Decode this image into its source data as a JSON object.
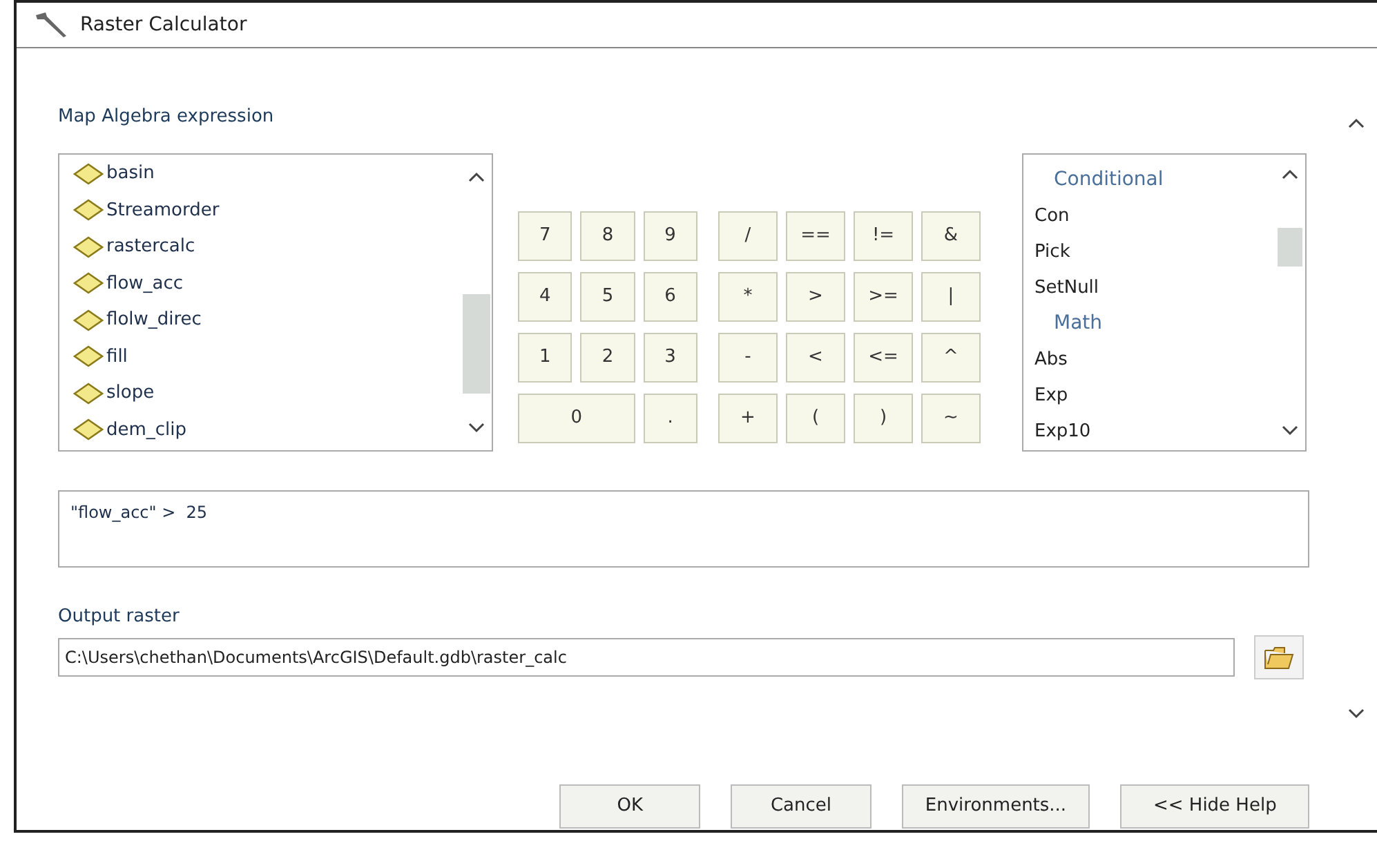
{
  "window": {
    "title": "Raster Calculator"
  },
  "expression_label": "Map Algebra expression",
  "layers": [
    "basin",
    "Streamorder",
    "rastercalc",
    "flow_acc",
    "flolw_direc",
    "fill",
    "slope",
    "dem_clip"
  ],
  "digit_keys": [
    {
      "label": "7",
      "kind": "normal"
    },
    {
      "label": "8",
      "kind": "normal"
    },
    {
      "label": "9",
      "kind": "normal"
    },
    {
      "label": "4",
      "kind": "normal"
    },
    {
      "label": "5",
      "kind": "normal"
    },
    {
      "label": "6",
      "kind": "normal"
    },
    {
      "label": "1",
      "kind": "normal"
    },
    {
      "label": "2",
      "kind": "normal"
    },
    {
      "label": "3",
      "kind": "normal"
    },
    {
      "label": "0",
      "kind": "wide"
    },
    {
      "label": ".",
      "kind": "normal"
    }
  ],
  "operator_keys": [
    "/",
    "==",
    "!=",
    "&",
    "*",
    ">",
    ">=",
    "|",
    "-",
    "<",
    "<=",
    "^",
    "+",
    "(",
    ")",
    "~"
  ],
  "functions": [
    {
      "label": "Conditional",
      "kind": "heading"
    },
    {
      "label": "Con",
      "kind": "function"
    },
    {
      "label": "Pick",
      "kind": "function"
    },
    {
      "label": "SetNull",
      "kind": "function"
    },
    {
      "label": "Math",
      "kind": "heading"
    },
    {
      "label": "Abs",
      "kind": "function"
    },
    {
      "label": "Exp",
      "kind": "function"
    },
    {
      "label": "Exp10",
      "kind": "function"
    }
  ],
  "expression": "\"flow_acc\" >  25",
  "output_label": "Output raster",
  "output_value": "C:\\Users\\chethan\\Documents\\ArcGIS\\Default.gdb\\raster_calc",
  "buttons": [
    "OK",
    "Cancel",
    "Environments...",
    "<< Hide Help"
  ]
}
